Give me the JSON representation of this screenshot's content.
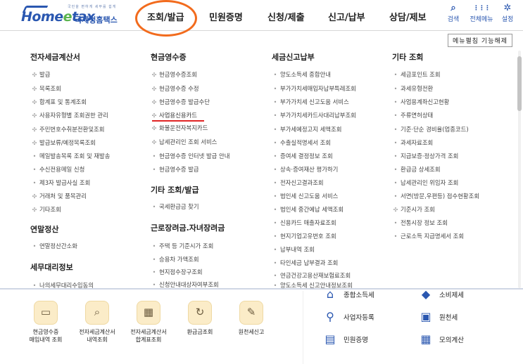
{
  "header": {
    "logo_small": "국민을 편하게 세무를 쉽게",
    "logo_main_1": "Home",
    "logo_main_e": "e",
    "logo_main_2": "tax",
    "logo_sub": "국세청홈택스",
    "nav": [
      "조회/발급",
      "민원증명",
      "신청/제출",
      "신고/납부",
      "상담/제보"
    ],
    "icons": [
      {
        "glyph": "⌕",
        "label": "검색",
        "icon": "search-icon"
      },
      {
        "glyph": "⋮⋮⋮",
        "label": "전체메뉴",
        "icon": "grid-menu-icon"
      },
      {
        "glyph": "✲",
        "label": "설정",
        "icon": "gear-icon"
      }
    ],
    "highlight_color": "#f26b1d",
    "brand_color": "#2a57b0"
  },
  "toggle_button": "메뉴펼침 기능해제",
  "columns": {
    "col1": {
      "sections": [
        {
          "title": "전자세금계산서",
          "items": [
            "발급",
            "목록조회",
            "합계표 및 통계조회",
            "사용자유형별 조회권한 관리",
            "주민번호수취분전환및조회",
            "발급보류/예정목록조회",
            "메일발송목록 조회 및 재발송",
            "수신전용메일 신청",
            "제3자 발급사실 조회",
            "거래처 및 품목관리",
            "기타조회"
          ]
        },
        {
          "title": "연말정산",
          "items": [
            "연말정산간소화"
          ]
        },
        {
          "title": "세무대리정보",
          "items": [
            "나의세무대리수임동의"
          ]
        }
      ]
    },
    "col2": {
      "sections": [
        {
          "title": "현금영수증",
          "items": [
            "현금영수증조회",
            "현금영수증 수정",
            "현금영수증 발급수단",
            "사업용신용카드",
            "화물운전자복지카드",
            "납세관리인 조회 서비스",
            "현금영수증 인터넷 발급 안내",
            "현금영수증 발급"
          ]
        },
        {
          "title": "기타 조회/발급",
          "items": [
            "국세환급금 찾기"
          ]
        },
        {
          "title": "근로장려금.자녀장려금",
          "items": [
            "주택 등 기준시가 조회",
            "승용차 가액조회",
            "현지점수장구조회",
            "신청안내대상자여부조회"
          ]
        }
      ]
    },
    "col3": {
      "sections": [
        {
          "title": "세금신고납부",
          "items": [
            "양도소득세 종합안내",
            "부가가치세매입자납부특례조회",
            "부가가치세 신고도움 서비스",
            "부가가치세카드사대리납부조회",
            "부가세예정고지 세액조회",
            "수출실적명세서 조회",
            "증여세 결정정보 조회",
            "상속·증여재산 평가하기",
            "전자신고결과조회",
            "법인세 신고도움 서비스",
            "법인세 중간예납 세액조회",
            "신용카드 매출자료조회",
            "현지기업고유번호 조회",
            "납부내역 조회",
            "타인세금 납부결과 조회",
            "연금건강고용산재보험료조회",
            "양도소득세 신고안내정보조회"
          ]
        }
      ]
    },
    "col4": {
      "sections": [
        {
          "title": "기타 조회",
          "items": [
            "세금포인트 조회",
            "과세유형전환",
            "사업용계좌신고현황",
            "주류면허상태",
            "기준·단순 경비율(업종코드)",
            "과세자료조회",
            "지급보증·정상가격 조회",
            "환급금 상세조회",
            "납세관리인 위임자 조회",
            "서면(방문,우편등) 접수현황조회",
            "기준시가 조회",
            "전통시장 정보 조회",
            "근로소득 지급명세서 조회"
          ]
        }
      ]
    }
  },
  "quick_menu": [
    {
      "label_1": "현금영수증",
      "label_2": "매입내역 조회",
      "glyph": "▭",
      "icon": "receipt-icon"
    },
    {
      "label_1": "전자세금계산서",
      "label_2": "내역조회",
      "glyph": "⌕",
      "icon": "invoice-search-icon"
    },
    {
      "label_1": "전자세금계산서",
      "label_2": "합계표조회",
      "glyph": "▦",
      "icon": "invoice-summary-icon"
    },
    {
      "label_1": "환급금조회",
      "label_2": "",
      "glyph": "↻",
      "icon": "refund-icon"
    },
    {
      "label_1": "원천세신고",
      "label_2": "",
      "glyph": "✎",
      "icon": "withholding-report-icon"
    }
  ],
  "right_menu": [
    {
      "label": "종합소득세",
      "glyph": "⌂",
      "icon": "income-tax-icon"
    },
    {
      "label": "소비제세",
      "glyph": "◆",
      "icon": "consumption-tax-icon"
    },
    {
      "label": "사업자등록",
      "glyph": "⚲",
      "icon": "business-registration-icon"
    },
    {
      "label": "원천세",
      "glyph": "▣",
      "icon": "withholding-tax-icon"
    },
    {
      "label": "민원증명",
      "glyph": "▤",
      "icon": "certificate-icon"
    },
    {
      "label": "모의계산",
      "glyph": "▦",
      "icon": "calculator-icon"
    }
  ]
}
